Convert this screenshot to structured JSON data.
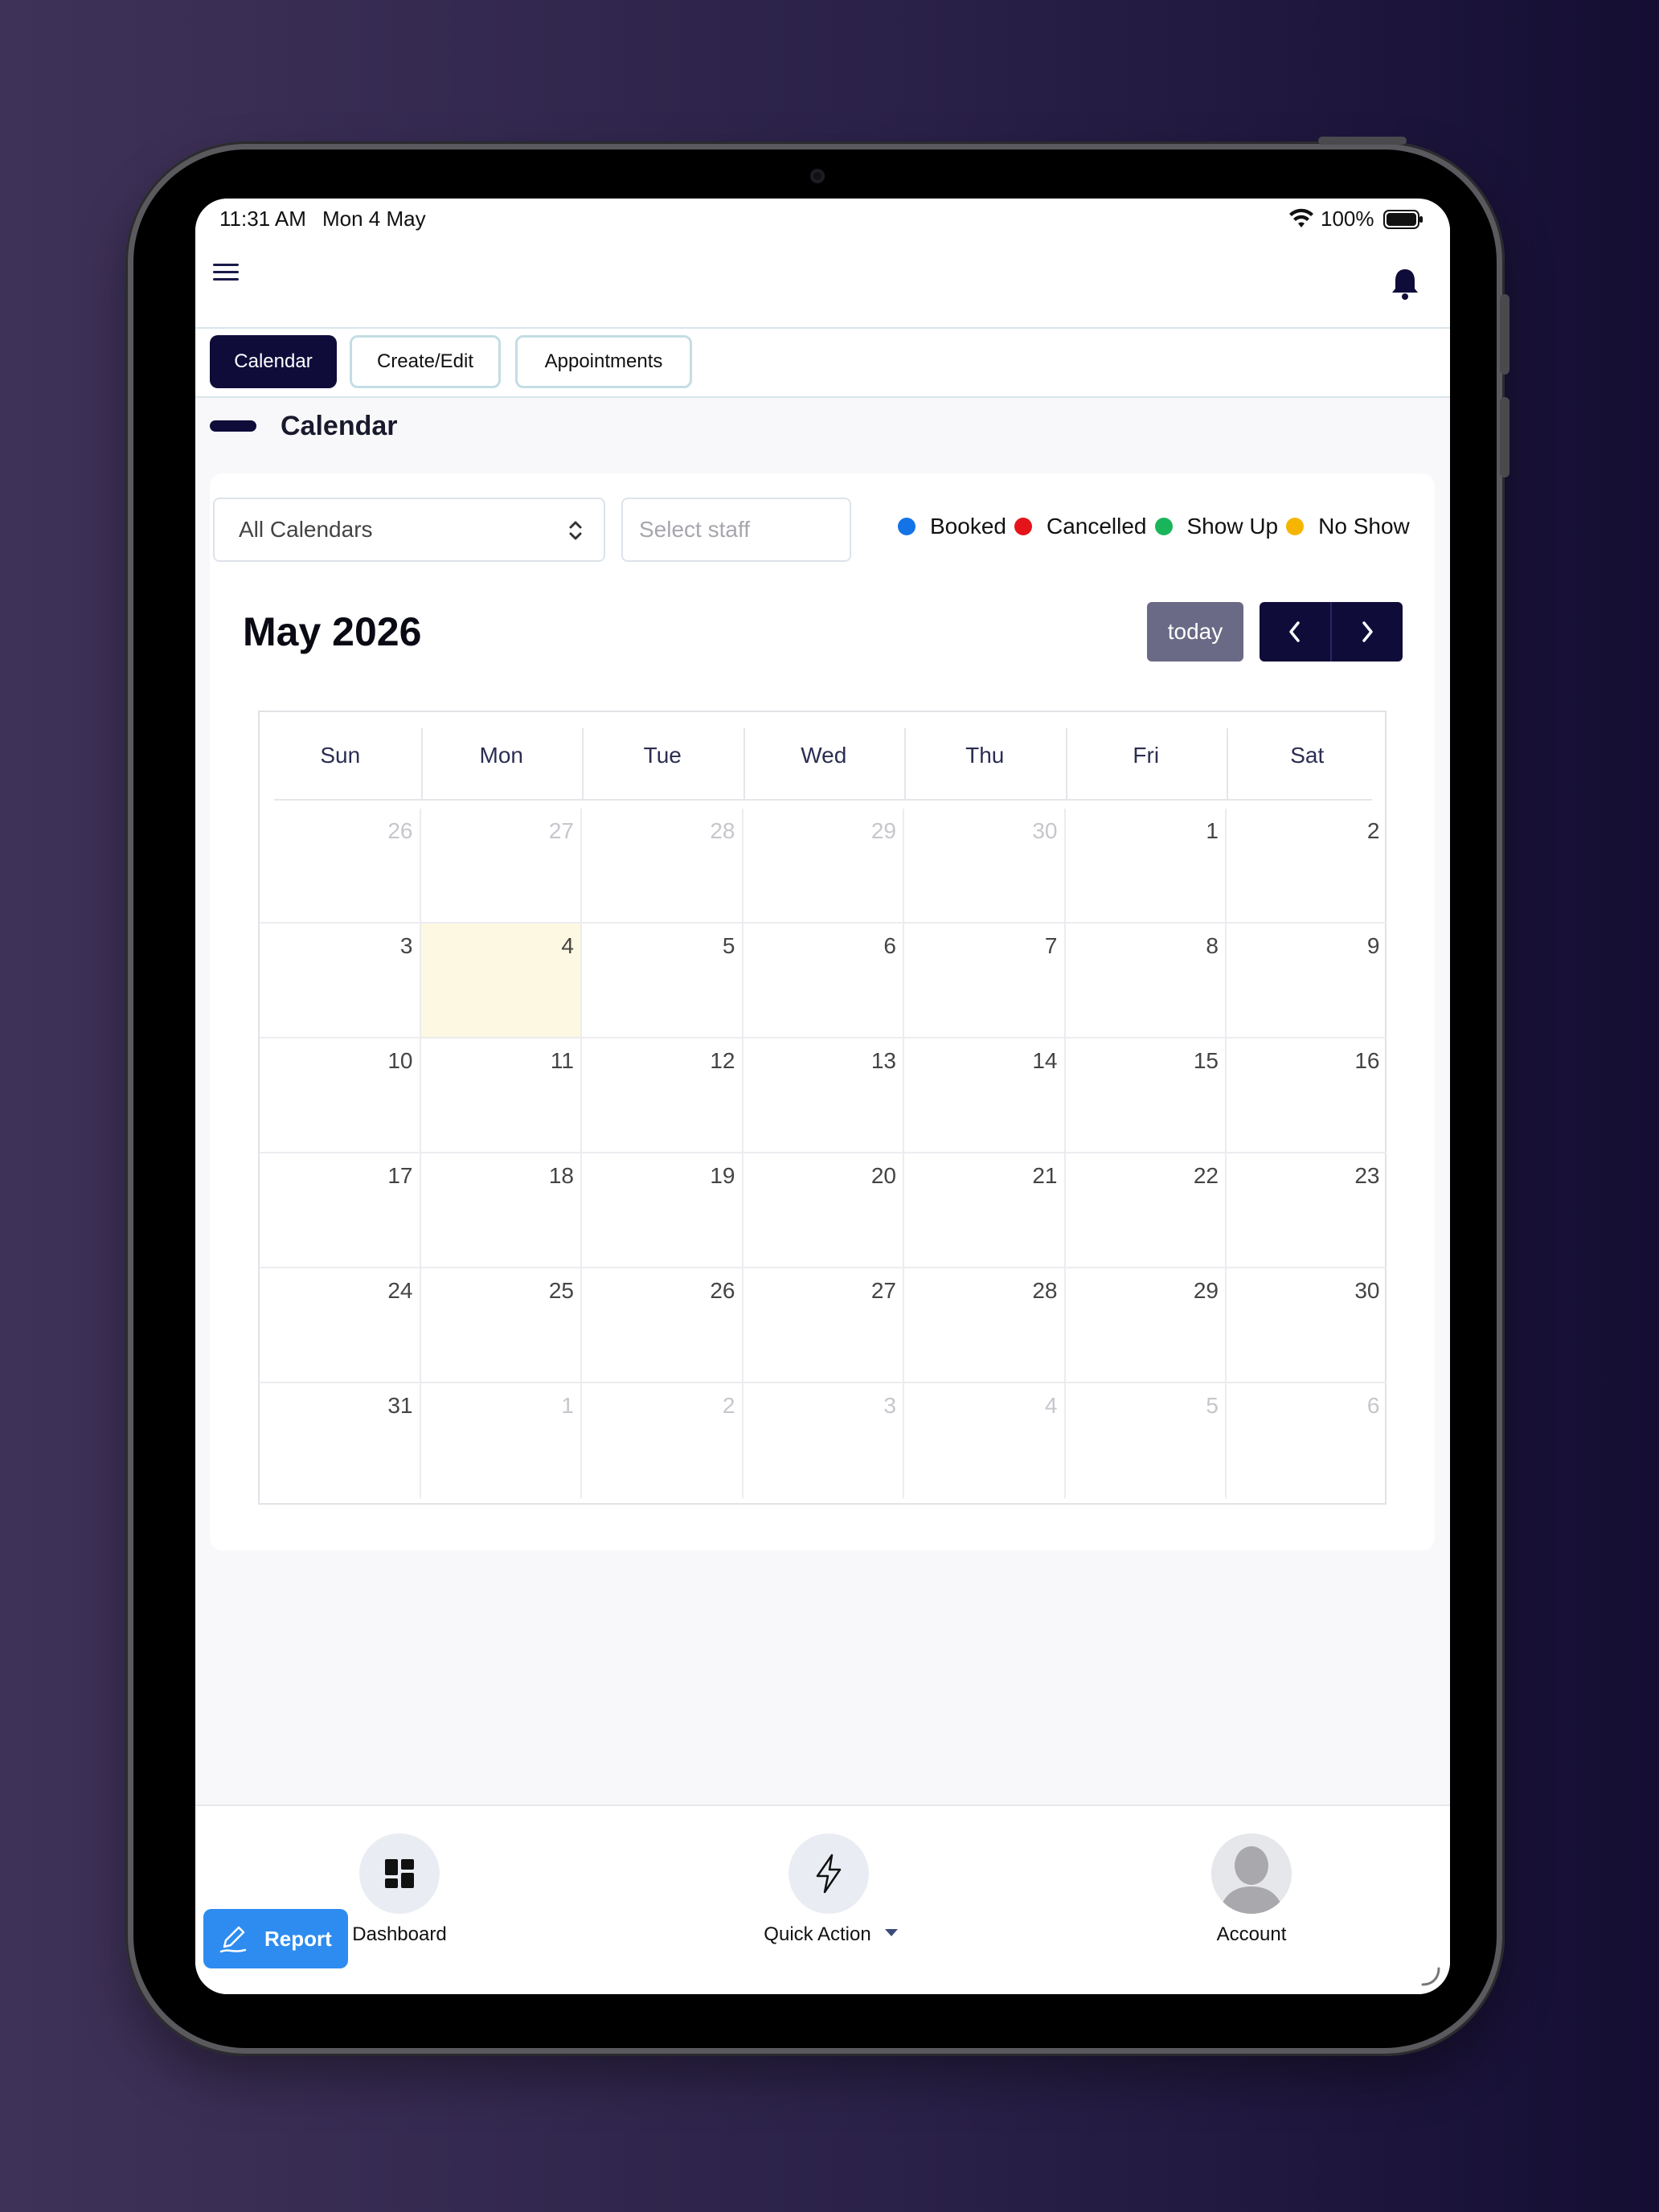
{
  "status_bar": {
    "time": "11:31 AM",
    "date": "Mon 4 May",
    "battery": "100%"
  },
  "tabs": [
    {
      "label": "Calendar",
      "active": true
    },
    {
      "label": "Create/Edit",
      "active": false
    },
    {
      "label": "Appointments",
      "active": false
    }
  ],
  "page_title": "Calendar",
  "filters": {
    "calendar_select": "All Calendars",
    "staff_placeholder": "Select staff"
  },
  "legend": [
    {
      "label": "Booked",
      "color": "#1473e6"
    },
    {
      "label": "Cancelled",
      "color": "#e5141b"
    },
    {
      "label": "Show Up",
      "color": "#19b55a"
    },
    {
      "label": "No Show",
      "color": "#f6b500"
    }
  ],
  "calendar": {
    "month_title": "May 2026",
    "today_label": "today",
    "weekdays": [
      "Sun",
      "Mon",
      "Tue",
      "Wed",
      "Thu",
      "Fri",
      "Sat"
    ],
    "weeks": [
      [
        "26",
        "27",
        "28",
        "29",
        "30",
        "1",
        "2"
      ],
      [
        "3",
        "4",
        "5",
        "6",
        "7",
        "8",
        "9"
      ],
      [
        "10",
        "11",
        "12",
        "13",
        "14",
        "15",
        "16"
      ],
      [
        "17",
        "18",
        "19",
        "20",
        "21",
        "22",
        "23"
      ],
      [
        "24",
        "25",
        "26",
        "27",
        "28",
        "29",
        "30"
      ],
      [
        "31",
        "1",
        "2",
        "3",
        "4",
        "5",
        "6"
      ]
    ]
  },
  "bottom_nav": {
    "dashboard": "Dashboard",
    "quick_action": "Quick Action",
    "account": "Account"
  },
  "report_button": "Report"
}
